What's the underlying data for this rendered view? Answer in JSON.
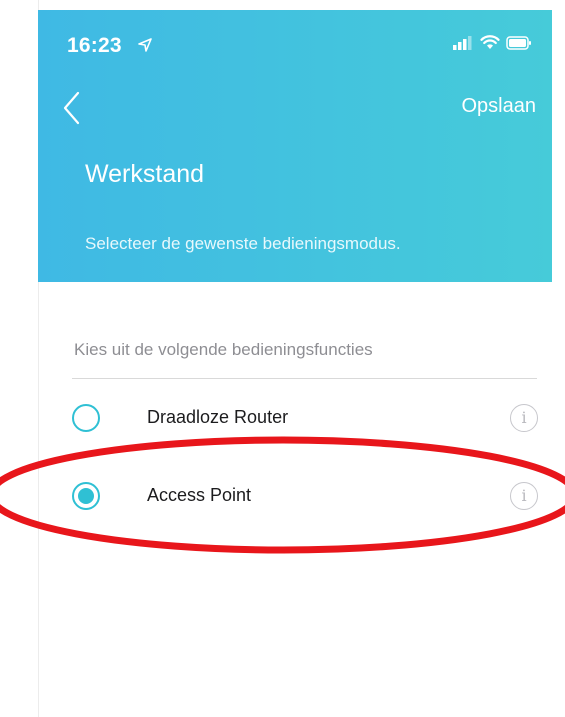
{
  "status_bar": {
    "time": "16:23",
    "location_icon": "location-arrow-icon",
    "signal_icon": "cellular-signal-icon",
    "wifi_icon": "wifi-icon",
    "battery_icon": "battery-icon"
  },
  "nav": {
    "back_icon": "chevron-left-icon",
    "save_label": "Opslaan"
  },
  "header": {
    "title": "Werkstand",
    "subtitle": "Selecteer de gewenste bedieningsmodus."
  },
  "section": {
    "label": "Kies uit de volgende bedieningsfuncties"
  },
  "options": [
    {
      "label": "Draadloze Router",
      "selected": false,
      "info_icon": "i"
    },
    {
      "label": "Access Point",
      "selected": true,
      "info_icon": "i"
    }
  ],
  "colors": {
    "header_gradient_start": "#3fb9e4",
    "header_gradient_end": "#46cbd9",
    "accent": "#2fc0d4",
    "annotation": "#e8161b"
  }
}
